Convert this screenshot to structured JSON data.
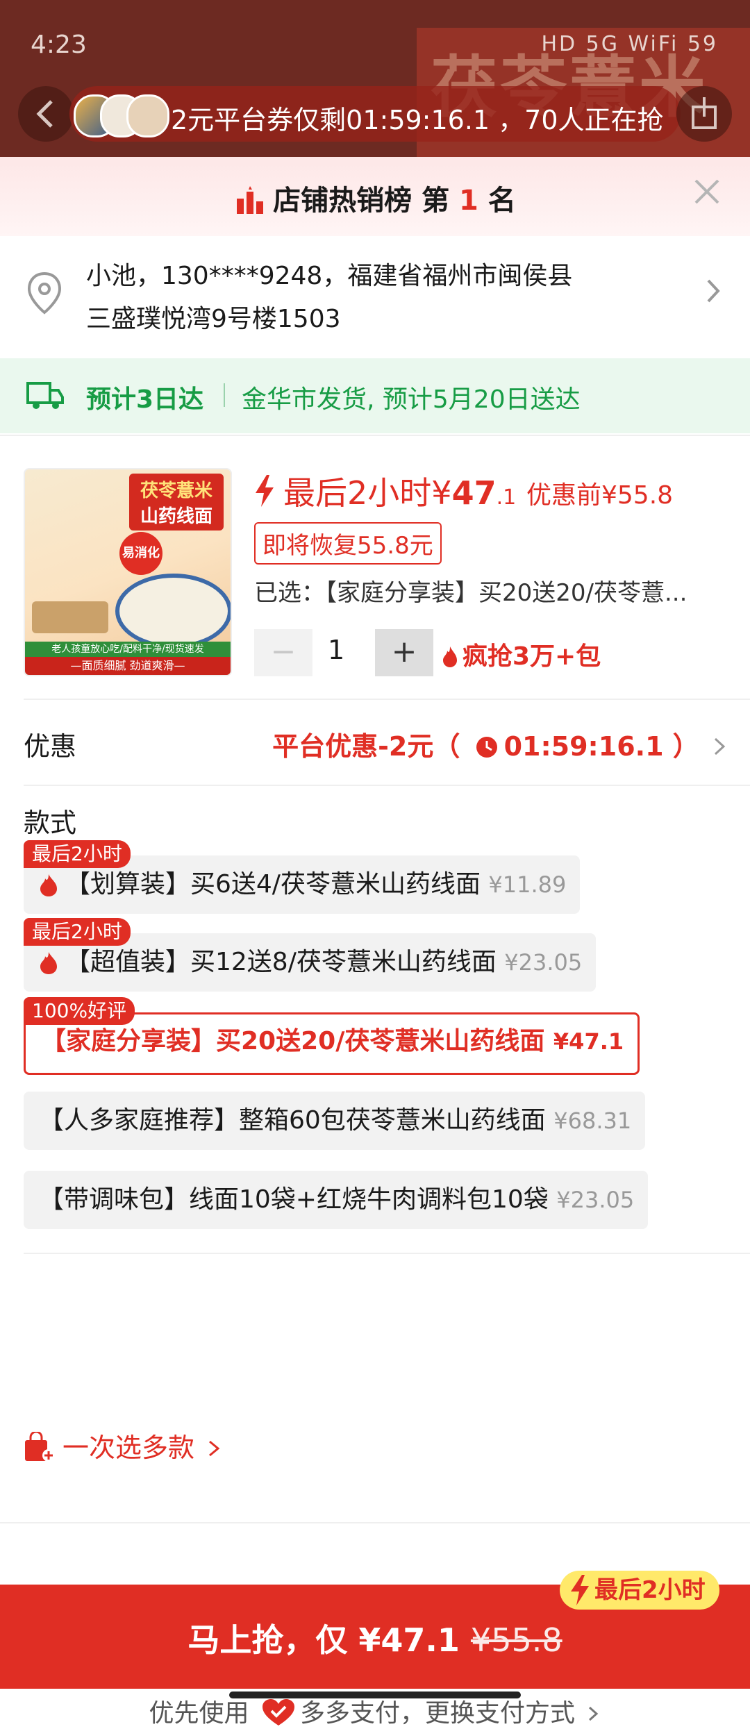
{
  "status": {
    "time": "4:23",
    "right": "HD 5G WiFi 59"
  },
  "coupon_bar": {
    "text": "2元平台券仅剩01:59:16.1 ，70人正在抢"
  },
  "background": {
    "banner": "茯苓薏米"
  },
  "rank": {
    "prefix": "店铺热销榜 第",
    "number": "1",
    "suffix": "名"
  },
  "address": {
    "line1": "小池，130****9248，福建省福州市闽侯县",
    "line2": "三盛璞悦湾9号楼1503"
  },
  "shipping": {
    "eta": "预计3日达",
    "detail": "金华市发货, 预计5月20日送达"
  },
  "product": {
    "image_title": "茯苓薏米",
    "image_subtitle": "山药线面",
    "image_badge": "易消化",
    "image_bottom": "老人孩童放心吃/配料干净/现货速发",
    "image_slogan": "—面质细腻 劲道爽滑—",
    "price_label": "最后2小时",
    "price_currency": "¥",
    "price_int": "47",
    "price_dec": ".1",
    "original": "优惠前¥55.8",
    "restore": "即将恢复55.8元",
    "selected_label": "已选：",
    "selected_value": "【家庭分享装】买20送20/茯苓薏..."
  },
  "quantity": {
    "minus": "−",
    "value": "1",
    "plus": "+",
    "hot": "疯抢3万+包"
  },
  "discount": {
    "label": "优惠",
    "value": "平台优惠-2元（",
    "timer": "01:59:16.1",
    "close": "）"
  },
  "styles": {
    "title": "款式",
    "options": [
      {
        "tag": "最后2小时",
        "label": "【划算装】买6送4/茯苓薏米山药线面",
        "price": "¥11.89"
      },
      {
        "tag": "最后2小时",
        "label": "【超值装】买12送8/茯苓薏米山药线面",
        "price": "¥23.05"
      },
      {
        "tag": "100%好评",
        "label": "【家庭分享装】买20送20/茯苓薏米山药线面",
        "price": "¥47.1"
      },
      {
        "tag": "",
        "label": "【人多家庭推荐】整箱60包茯苓薏米山药线面",
        "price": "¥68.31"
      },
      {
        "tag": "",
        "label": "【带调味包】线面10袋+红烧牛肉调料包10袋",
        "price": "¥23.05"
      }
    ]
  },
  "multi_select": {
    "label": "一次选多款"
  },
  "payment": {
    "prefix": "优先使用",
    "method": "多多支付，更换支付方式"
  },
  "buy": {
    "label": "马上抢，仅 ¥47.1",
    "old": "¥55.8",
    "tag": "最后2小时"
  },
  "colors": {
    "accent": "#e02e24",
    "green": "#179c45"
  }
}
